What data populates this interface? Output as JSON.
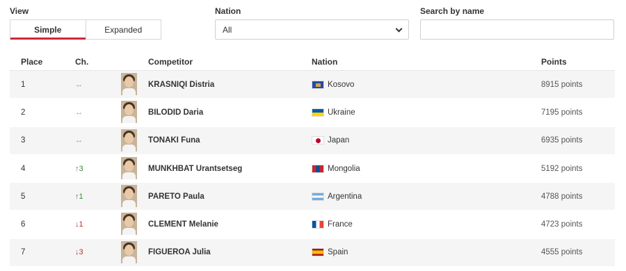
{
  "view": {
    "label": "View",
    "options": [
      "Simple",
      "Expanded"
    ],
    "selected": "Simple"
  },
  "nation_filter": {
    "label": "Nation",
    "value": "All"
  },
  "search": {
    "label": "Search by name",
    "value": "",
    "placeholder": ""
  },
  "table": {
    "headers": {
      "place": "Place",
      "change": "Ch.",
      "competitor": "Competitor",
      "nation": "Nation",
      "points": "Points"
    },
    "rows": [
      {
        "place": "1",
        "change": "↔",
        "change_type": "same",
        "name": "KRASNIQI Distria",
        "nation": "Kosovo",
        "flag": "kosovo",
        "points": "8915 points"
      },
      {
        "place": "2",
        "change": "↔",
        "change_type": "same",
        "name": "BILODID Daria",
        "nation": "Ukraine",
        "flag": "ukraine",
        "points": "7195 points"
      },
      {
        "place": "3",
        "change": "↔",
        "change_type": "same",
        "name": "TONAKI Funa",
        "nation": "Japan",
        "flag": "japan",
        "points": "6935 points"
      },
      {
        "place": "4",
        "change": "↑3",
        "change_type": "up",
        "name": "MUNKHBAT Urantsetseg",
        "nation": "Mongolia",
        "flag": "mongolia",
        "points": "5192 points"
      },
      {
        "place": "5",
        "change": "↑1",
        "change_type": "up",
        "name": "PARETO Paula",
        "nation": "Argentina",
        "flag": "argentina",
        "points": "4788 points"
      },
      {
        "place": "6",
        "change": "↓1",
        "change_type": "down",
        "name": "CLEMENT Melanie",
        "nation": "France",
        "flag": "france",
        "points": "4723 points"
      },
      {
        "place": "7",
        "change": "↓3",
        "change_type": "down",
        "name": "FIGUEROA Julia",
        "nation": "Spain",
        "flag": "spain",
        "points": "4555 points"
      }
    ]
  },
  "colors": {
    "accent": "#d0263a",
    "row_stripe": "#f5f5f5",
    "up": "#3a8a3a",
    "down": "#b03030"
  }
}
